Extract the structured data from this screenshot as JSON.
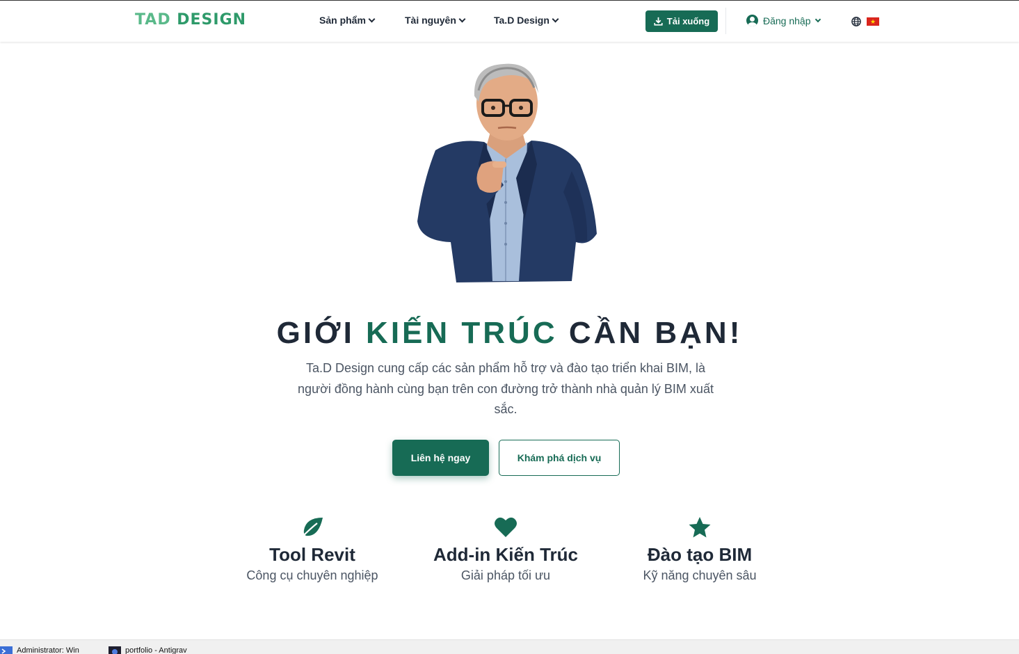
{
  "header": {
    "logo_text_a": "TAD ",
    "logo_text_b": "DESIGN",
    "nav": [
      {
        "label": "Sản phẩm"
      },
      {
        "label": "Tài nguyên"
      },
      {
        "label": "Ta.D Design"
      }
    ],
    "download_label": "Tải xuống",
    "login_label": "Đăng nhập",
    "flag_symbol": "★"
  },
  "hero": {
    "headline_part1": "GIỚI ",
    "headline_accent": "KIẾN TRÚC",
    "headline_part2": " CẦN BẠN!",
    "subtitle": "Ta.D Design cung cấp các sản phẩm hỗ trợ và đào tạo triển khai BIM, là người đồng hành cùng bạn trên con đường trở thành nhà quản lý BIM xuất sắc.",
    "cta_primary": "Liên hệ ngay",
    "cta_secondary": "Khám phá dịch vụ"
  },
  "features": [
    {
      "icon": "leaf-icon",
      "title": "Tool Revit",
      "subtitle": "Công cụ chuyên nghiệp"
    },
    {
      "icon": "heart-icon",
      "title": "Add-in Kiến Trúc",
      "subtitle": "Giải pháp tối ưu"
    },
    {
      "icon": "star-icon",
      "title": "Đào tạo BIM",
      "subtitle": "Kỹ năng chuyên sâu"
    }
  ],
  "taskbar": {
    "items": [
      {
        "label": "Administrator: Win"
      },
      {
        "label": "portfolio - Antigrav"
      }
    ]
  },
  "colors": {
    "brand": "#176b55",
    "logo": "#5ab98a",
    "text": "#1f2937",
    "muted": "#4b5563"
  }
}
